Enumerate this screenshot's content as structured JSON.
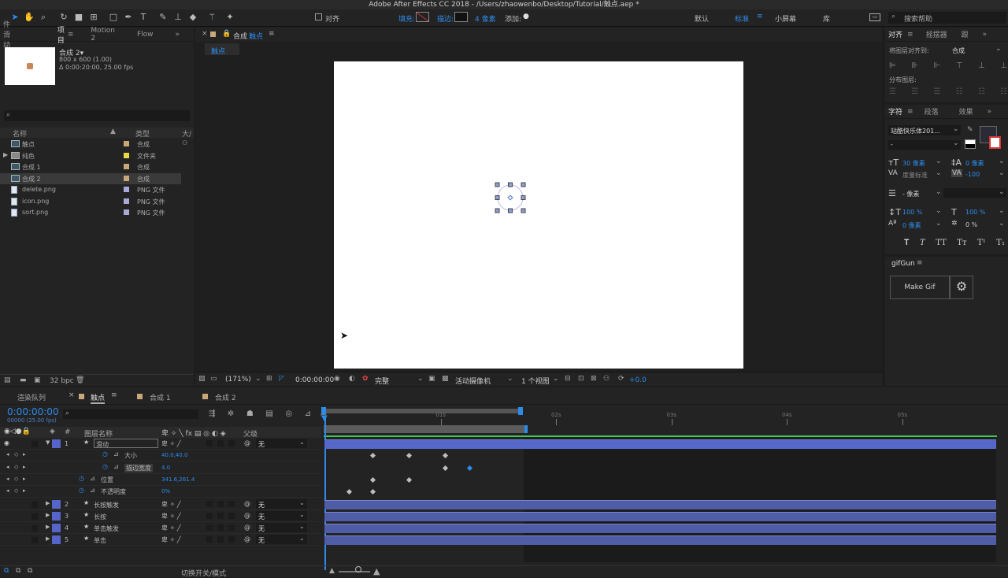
{
  "window": {
    "title": "Adobe After Effects CC 2018 - /Users/zhaowenbo/Desktop/Tutorial/触点.aep *"
  },
  "toolbar": {
    "align_label": "对齐",
    "fill_label": "填充:",
    "stroke_label": "描边:",
    "stroke_value": "4 像素",
    "add_label": "添加:",
    "workspaces": [
      "默认",
      "标准",
      "小屏幕",
      "库"
    ],
    "search_placeholder": "搜索帮助"
  },
  "project": {
    "tabs": [
      "件 滑动",
      "项目",
      "Motion 2",
      "Flow"
    ],
    "comp_name": "合成 2▾",
    "comp_info": "800 x 600 (1.00)",
    "comp_duration": "Δ 0:00:20:00, 25.00 fps",
    "col_name": "名称",
    "col_type": "类型",
    "col_size": "大/",
    "items": [
      {
        "name": "触点",
        "type": "合成",
        "color": "#c8a77a"
      },
      {
        "name": "纯色",
        "type": "文件夹",
        "color": "#e8d84a"
      },
      {
        "name": "合成 1",
        "type": "合成",
        "color": "#c8a77a"
      },
      {
        "name": "合成 2",
        "type": "合成",
        "color": "#c8a77a"
      },
      {
        "name": "delete.png",
        "type": "PNG 文件",
        "color": "#a9a9d9"
      },
      {
        "name": "icon.png",
        "type": "PNG 文件",
        "color": "#a9a9d9"
      },
      {
        "name": "sort.png",
        "type": "PNG 文件",
        "color": "#a9a9d9"
      }
    ],
    "bpc": "32 bpc"
  },
  "composition": {
    "title": "合成",
    "comp": "触点",
    "sub_tab": "触点",
    "zoom": "(171%)",
    "timecode": "0:00:00:00",
    "quality": "完整",
    "camera": "活动摄像机",
    "views": "1 个视图",
    "exposure": "+0.0"
  },
  "align": {
    "tabs": [
      "对齐",
      "摇摆器",
      "跟"
    ],
    "align_to_label": "将图层对齐到:",
    "align_to_value": "合成",
    "distribute_label": "分布图层:"
  },
  "character": {
    "tabs": [
      "字符",
      "段落",
      "效果"
    ],
    "font": "站酷快乐体201...",
    "style": "-",
    "size": "30 像素",
    "leading": "0 像素",
    "kerning": "度量标准",
    "tracking": "-100",
    "stroke": "- 像素",
    "vscale": "100 %",
    "hscale": "100 %",
    "baseline": "0 像素",
    "tsume": "0 %"
  },
  "gifgun": {
    "title": "gifGun",
    "button": "Make Gif"
  },
  "timeline": {
    "tabs": [
      "渲染队列",
      "触点",
      "合成 1",
      "合成 2"
    ],
    "timecode": "0:00:00:00",
    "frames": "00000 (25.00 fps)",
    "col_layername": "图层名称",
    "col_parent": "父级",
    "ruler": [
      "0s",
      "01s",
      "02s",
      "03s",
      "04s",
      "05s"
    ],
    "layers": [
      {
        "num": "1",
        "name": "滑动",
        "parent": "无"
      },
      {
        "num": "2",
        "name": "长按触发",
        "parent": "无"
      },
      {
        "num": "3",
        "name": "长按",
        "parent": "无"
      },
      {
        "num": "4",
        "name": "单击触发",
        "parent": "无"
      },
      {
        "num": "5",
        "name": "单击",
        "parent": "无"
      }
    ],
    "props": [
      {
        "name": "大小",
        "value": "40.0,40.0"
      },
      {
        "name": "描边宽度",
        "value": "4.0"
      },
      {
        "name": "位置",
        "value": "341.6,261.4"
      },
      {
        "name": "不透明度",
        "value": "0%"
      }
    ],
    "footer": "切换开关/模式"
  }
}
